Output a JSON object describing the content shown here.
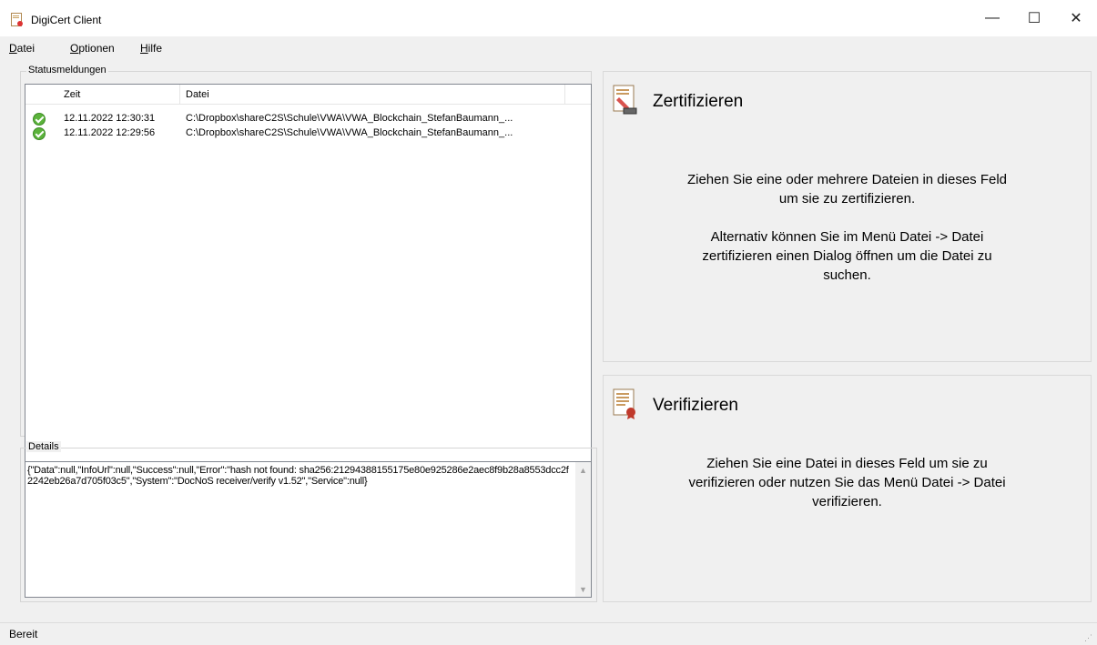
{
  "window": {
    "title": "DigiCert Client",
    "minimize_label": "—",
    "maximize_label": "☐",
    "close_label": "✕"
  },
  "menu": {
    "items": [
      {
        "accel": "D",
        "rest": "atei"
      },
      {
        "accel": "O",
        "rest": "ptionen"
      },
      {
        "accel": "H",
        "rest": "ilfe"
      }
    ]
  },
  "status_group": {
    "legend": "Statusmeldungen",
    "columns": [
      "Zeit",
      "Datei"
    ],
    "rows": [
      {
        "status_icon": "check-circle-icon",
        "time": "12.11.2022 12:30:31",
        "file": "C:\\Dropbox\\shareC2S\\Schule\\VWA\\VWA_Blockchain_StefanBaumann_..."
      },
      {
        "status_icon": "check-circle-icon",
        "time": "12.11.2022 12:29:56",
        "file": "C:\\Dropbox\\shareC2S\\Schule\\VWA\\VWA_Blockchain_StefanBaumann_..."
      }
    ]
  },
  "details_group": {
    "legend": "Details",
    "text": "{\"Data\":null,\"InfoUrl\":null,\"Success\":null,\"Error\":\"hash not found: sha256:21294388155175e80e925286e2aec8f9b28a8553dcc2f2242eb26a7d705f03c5\",\"System\":\"DocNoS receiver/verify v1.52\",\"Service\":null}"
  },
  "certify_panel": {
    "icon": "certify-document-icon",
    "title": "Zertifizieren",
    "text1_line1": "Ziehen Sie eine oder mehrere Dateien in dieses Feld",
    "text1_line2": "um sie zu zertifizieren.",
    "text2_line1": "Alternativ können Sie im Menü Datei -> Datei",
    "text2_line2": "zertifizieren einen Dialog öffnen um die Datei zu",
    "text2_line3": "suchen."
  },
  "verify_panel": {
    "icon": "verify-document-icon",
    "title": "Verifizieren",
    "text_line1": "Ziehen Sie eine Datei in dieses Feld um sie zu",
    "text_line2": "verifizieren oder nutzen Sie das Menü Datei -> Datei",
    "text_line3": "verifizieren."
  },
  "statusbar": {
    "text": "Bereit"
  },
  "colors": {
    "success": "#5bb33b",
    "window_bg": "#f0f0f0",
    "list_border": "#828790"
  }
}
